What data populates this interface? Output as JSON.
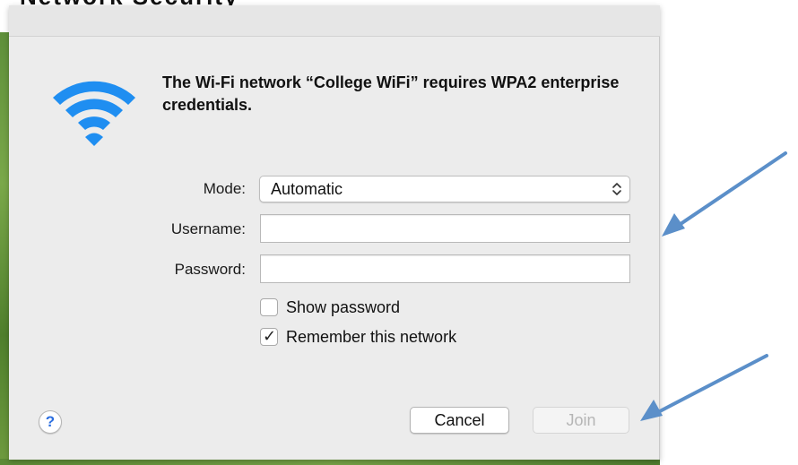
{
  "page": {
    "top_cut_text": "Network Security"
  },
  "dialog": {
    "icon": "wifi-icon",
    "message": "The Wi-Fi network “College WiFi” requires WPA2 enterprise credentials.",
    "mode": {
      "label": "Mode:",
      "selected": "Automatic"
    },
    "username": {
      "label": "Username:",
      "value": "",
      "placeholder": ""
    },
    "password": {
      "label": "Password:",
      "value": "",
      "placeholder": ""
    },
    "show_password": {
      "label": "Show password",
      "checked": false
    },
    "remember_network": {
      "label": "Remember this network",
      "checked": true
    },
    "help_label": "?",
    "cancel_label": "Cancel",
    "join_label": "Join"
  },
  "colors": {
    "wifi_blue": "#1f8ef1",
    "help_blue": "#2c6fe0",
    "annotation_arrow": "#5b8fc9",
    "dialog_background": "#ececec"
  }
}
